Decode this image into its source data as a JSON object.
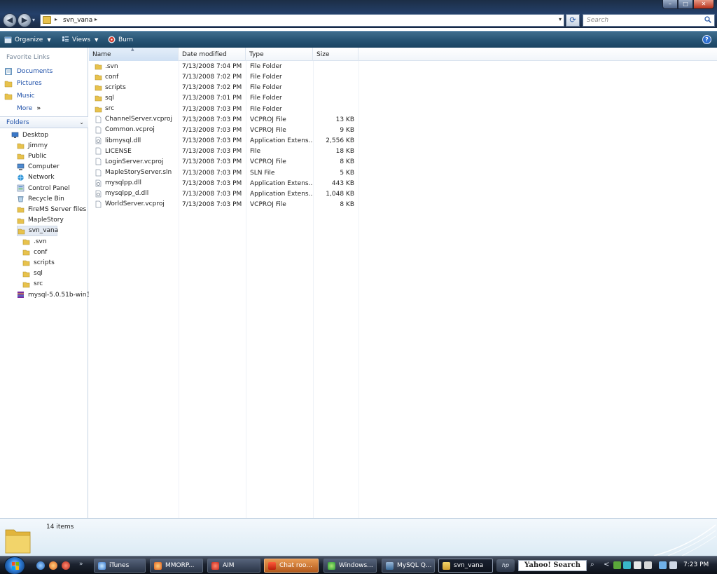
{
  "address": {
    "path": "svn_vana",
    "search_placeholder": "Search"
  },
  "window_controls": {
    "minimize": "–",
    "maximize": "□",
    "close": "✕"
  },
  "commands": {
    "organize": "Organize",
    "views": "Views",
    "burn": "Burn",
    "help": "?"
  },
  "nav": {
    "favorites_header": "Favorite Links",
    "favorites": [
      {
        "label": "Documents",
        "icon": "documents-icon"
      },
      {
        "label": "Pictures",
        "icon": "pictures-icon"
      },
      {
        "label": "Music",
        "icon": "music-icon"
      },
      {
        "label": "More",
        "suffix": "»"
      }
    ],
    "folders_header": "Folders",
    "tree": [
      {
        "label": "Desktop",
        "icon": "desktop-icon",
        "indent": 0
      },
      {
        "label": "Jimmy",
        "icon": "folder-icon",
        "indent": 1
      },
      {
        "label": "Public",
        "icon": "folder-icon",
        "indent": 1
      },
      {
        "label": "Computer",
        "icon": "computer-icon",
        "indent": 1
      },
      {
        "label": "Network",
        "icon": "network-icon",
        "indent": 1
      },
      {
        "label": "Control Panel",
        "icon": "control-panel-icon",
        "indent": 1
      },
      {
        "label": "Recycle Bin",
        "icon": "recycle-bin-icon",
        "indent": 1
      },
      {
        "label": "FireMS Server files",
        "icon": "folder-icon",
        "indent": 1
      },
      {
        "label": "MapleStory",
        "icon": "folder-icon",
        "indent": 1
      },
      {
        "label": "svn_vana",
        "icon": "folder-icon",
        "indent": 1,
        "selected": true
      },
      {
        "label": ".svn",
        "icon": "folder-icon",
        "indent": 2
      },
      {
        "label": "conf",
        "icon": "folder-icon",
        "indent": 2
      },
      {
        "label": "scripts",
        "icon": "folder-icon",
        "indent": 2
      },
      {
        "label": "sql",
        "icon": "folder-icon",
        "indent": 2
      },
      {
        "label": "src",
        "icon": "folder-icon",
        "indent": 2
      },
      {
        "label": "mysql-5.0.51b-win3",
        "icon": "archive-icon",
        "indent": 1
      }
    ]
  },
  "columns": {
    "name": "Name",
    "date": "Date modified",
    "type": "Type",
    "size": "Size"
  },
  "files": [
    {
      "name": ".svn",
      "date": "7/13/2008 7:04 PM",
      "type": "File Folder",
      "size": "",
      "icon": "folder-icon"
    },
    {
      "name": "conf",
      "date": "7/13/2008 7:02 PM",
      "type": "File Folder",
      "size": "",
      "icon": "folder-icon"
    },
    {
      "name": "scripts",
      "date": "7/13/2008 7:02 PM",
      "type": "File Folder",
      "size": "",
      "icon": "folder-icon"
    },
    {
      "name": "sql",
      "date": "7/13/2008 7:01 PM",
      "type": "File Folder",
      "size": "",
      "icon": "folder-icon"
    },
    {
      "name": "src",
      "date": "7/13/2008 7:03 PM",
      "type": "File Folder",
      "size": "",
      "icon": "folder-icon"
    },
    {
      "name": "ChannelServer.vcproj",
      "date": "7/13/2008 7:03 PM",
      "type": "VCPROJ File",
      "size": "13 KB",
      "icon": "file-icon"
    },
    {
      "name": "Common.vcproj",
      "date": "7/13/2008 7:03 PM",
      "type": "VCPROJ File",
      "size": "9 KB",
      "icon": "file-icon"
    },
    {
      "name": "libmysql.dll",
      "date": "7/13/2008 7:03 PM",
      "type": "Application Extens...",
      "size": "2,556 KB",
      "icon": "dll-icon"
    },
    {
      "name": "LICENSE",
      "date": "7/13/2008 7:03 PM",
      "type": "File",
      "size": "18 KB",
      "icon": "file-icon"
    },
    {
      "name": "LoginServer.vcproj",
      "date": "7/13/2008 7:03 PM",
      "type": "VCPROJ File",
      "size": "8 KB",
      "icon": "file-icon"
    },
    {
      "name": "MapleStoryServer.sln",
      "date": "7/13/2008 7:03 PM",
      "type": "SLN File",
      "size": "5 KB",
      "icon": "file-icon"
    },
    {
      "name": "mysqlpp.dll",
      "date": "7/13/2008 7:03 PM",
      "type": "Application Extens...",
      "size": "443 KB",
      "icon": "dll-icon"
    },
    {
      "name": "mysqlpp_d.dll",
      "date": "7/13/2008 7:03 PM",
      "type": "Application Extens...",
      "size": "1,048 KB",
      "icon": "dll-icon"
    },
    {
      "name": "WorldServer.vcproj",
      "date": "7/13/2008 7:03 PM",
      "type": "VCPROJ File",
      "size": "8 KB",
      "icon": "file-icon"
    }
  ],
  "details": {
    "item_count": "14 items"
  },
  "taskbar": {
    "quick_launch_more": "»",
    "tasks": [
      {
        "label": "iTunes",
        "icon": "itunes-icon",
        "state": "normal"
      },
      {
        "label": "MMORP...",
        "icon": "firefox-icon",
        "state": "normal"
      },
      {
        "label": "AIM",
        "icon": "aim-icon",
        "state": "normal"
      },
      {
        "label": "Chat roo...",
        "icon": "chat-icon",
        "state": "flash"
      },
      {
        "label": "Windows...",
        "icon": "messenger-icon",
        "state": "normal"
      },
      {
        "label": "MySQL Q...",
        "icon": "mysql-icon",
        "state": "normal"
      },
      {
        "label": "svn_vana",
        "icon": "folder-icon",
        "state": "active"
      }
    ],
    "hp_label": "hp",
    "yahoo_search": "Yahoo! Search",
    "tray_expand": "<",
    "clock": "7:23 PM"
  }
}
